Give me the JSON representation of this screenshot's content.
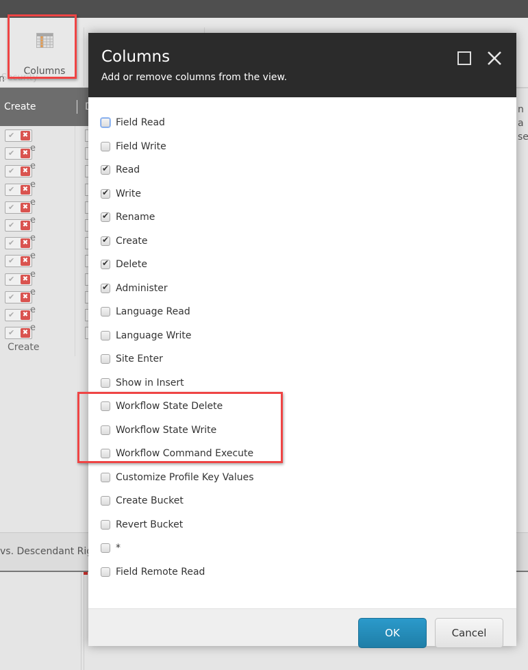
{
  "ribbon": {
    "partial_left_label": "n",
    "columns_button_label": "Columns",
    "group_label": "Security"
  },
  "grid": {
    "header_create": "Create",
    "header_next_partial": "D",
    "cell_ghost_text": "Create",
    "row_count": 12,
    "footer_label": "Create"
  },
  "background": {
    "descendant_bar_text": "vs. Descendant Rig",
    "right_partial_line1": "n a",
    "right_partial_line2": "se"
  },
  "dialog": {
    "title": "Columns",
    "subtitle": "Add or remove columns from the view.",
    "maximize_label": "Maximize",
    "close_label": "Close",
    "options": [
      {
        "label": "Field Read",
        "checked": false,
        "focused": true
      },
      {
        "label": "Field Write",
        "checked": false
      },
      {
        "label": "Read",
        "checked": true
      },
      {
        "label": "Write",
        "checked": true
      },
      {
        "label": "Rename",
        "checked": true
      },
      {
        "label": "Create",
        "checked": true
      },
      {
        "label": "Delete",
        "checked": true
      },
      {
        "label": "Administer",
        "checked": true
      },
      {
        "label": "Language Read",
        "checked": false
      },
      {
        "label": "Language Write",
        "checked": false
      },
      {
        "label": "Site Enter",
        "checked": false
      },
      {
        "label": "Show in Insert",
        "checked": false
      },
      {
        "label": "Workflow State Delete",
        "checked": false,
        "highlighted": true
      },
      {
        "label": "Workflow State Write",
        "checked": false,
        "highlighted": true
      },
      {
        "label": "Workflow Command Execute",
        "checked": false,
        "highlighted": true
      },
      {
        "label": "Customize Profile Key Values",
        "checked": false
      },
      {
        "label": "Create Bucket",
        "checked": false
      },
      {
        "label": "Revert Bucket",
        "checked": false
      },
      {
        "label": "*",
        "checked": false
      },
      {
        "label": "Field Remote Read",
        "checked": false
      }
    ],
    "ok_label": "OK",
    "cancel_label": "Cancel"
  },
  "colors": {
    "highlight_red": "#ef4444",
    "ok_blue": "#2b9acb",
    "deny_red": "#d9534f",
    "dialog_header": "#2b2b2b"
  }
}
